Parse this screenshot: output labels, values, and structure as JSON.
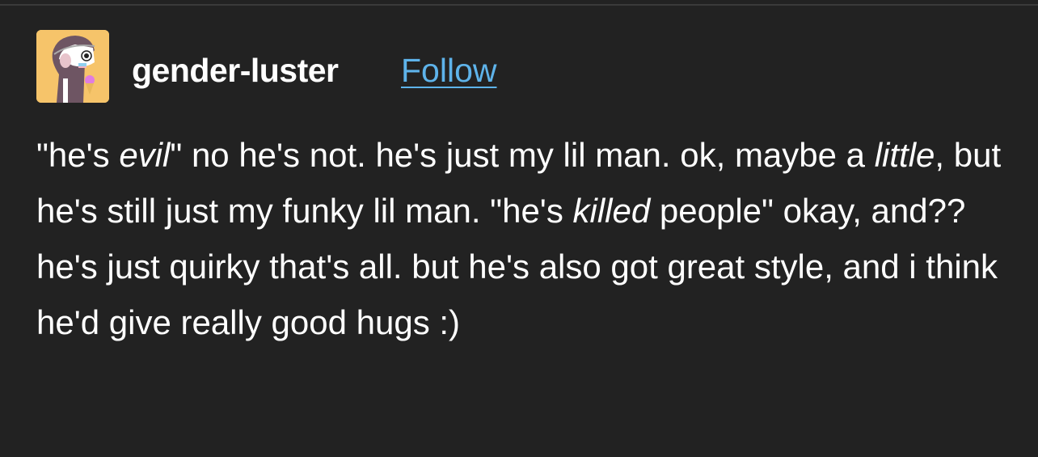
{
  "post": {
    "author": "gender-luster",
    "follow_label": "Follow",
    "avatar_icon": "avatar-image",
    "body_segments": [
      {
        "text": "\"he's ",
        "italic": false
      },
      {
        "text": "evil",
        "italic": true
      },
      {
        "text": "\"  no he's not. he's just my lil man. ok, maybe a ",
        "italic": false
      },
      {
        "text": "little",
        "italic": true
      },
      {
        "text": ", but he's still just my funky lil man. \"he's ",
        "italic": false
      },
      {
        "text": "killed",
        "italic": true
      },
      {
        "text": " people\" okay, and?? he's just quirky that's all. but he's also got great style, and i think he'd give really good hugs :)",
        "italic": false
      }
    ]
  },
  "colors": {
    "background": "#222222",
    "link": "#5eb3ea",
    "avatar_bg": "#f6c46a"
  }
}
